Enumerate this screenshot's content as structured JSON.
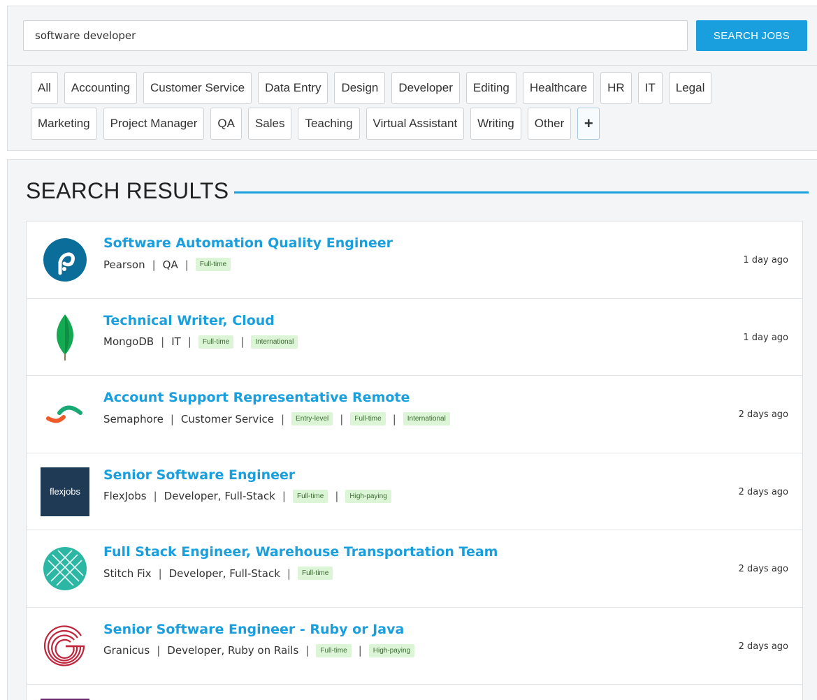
{
  "search": {
    "query": "software developer",
    "button_label": "SEARCH JOBS"
  },
  "categories": {
    "row1": [
      "All",
      "Accounting",
      "Customer Service",
      "Data Entry",
      "Design",
      "Developer",
      "Editing",
      "Healthcare",
      "HR",
      "IT",
      "Legal"
    ],
    "row2": [
      "Marketing",
      "Project Manager",
      "QA",
      "Sales",
      "Teaching",
      "Virtual Assistant",
      "Writing",
      "Other"
    ],
    "add_label": "+"
  },
  "results": {
    "heading": "SEARCH RESULTS",
    "jobs": [
      {
        "title": "Software Automation Quality Engineer",
        "company": "Pearson",
        "category": "QA",
        "tags": [
          "Full-time"
        ],
        "posted": "1 day ago",
        "logo": "pearson-logo"
      },
      {
        "title": "Technical Writer, Cloud",
        "company": "MongoDB",
        "category": "IT",
        "tags": [
          "Full-time",
          "International"
        ],
        "posted": "1 day ago",
        "logo": "mongodb-logo"
      },
      {
        "title": "Account Support Representative Remote",
        "company": "Semaphore",
        "category": "Customer Service",
        "tags": [
          "Entry-level",
          "Full-time",
          "International"
        ],
        "posted": "2 days ago",
        "logo": "semaphore-logo"
      },
      {
        "title": "Senior Software Engineer",
        "company": "FlexJobs",
        "category": "Developer, Full-Stack",
        "tags": [
          "Full-time",
          "High-paying"
        ],
        "posted": "2 days ago",
        "logo": "flexjobs-logo",
        "logo_text": "flexjobs"
      },
      {
        "title": "Full Stack Engineer, Warehouse Transportation Team",
        "company": "Stitch Fix",
        "category": "Developer, Full-Stack",
        "tags": [
          "Full-time"
        ],
        "posted": "2 days ago",
        "logo": "stitchfix-logo"
      },
      {
        "title": "Senior Software Engineer - Ruby or Java",
        "company": "Granicus",
        "category": "Developer, Ruby on Rails",
        "tags": [
          "Full-time",
          "High-paying"
        ],
        "posted": "2 days ago",
        "logo": "granicus-logo"
      }
    ]
  },
  "colors": {
    "accent": "#1a9fde",
    "tag_bg": "#dcf5d6"
  }
}
